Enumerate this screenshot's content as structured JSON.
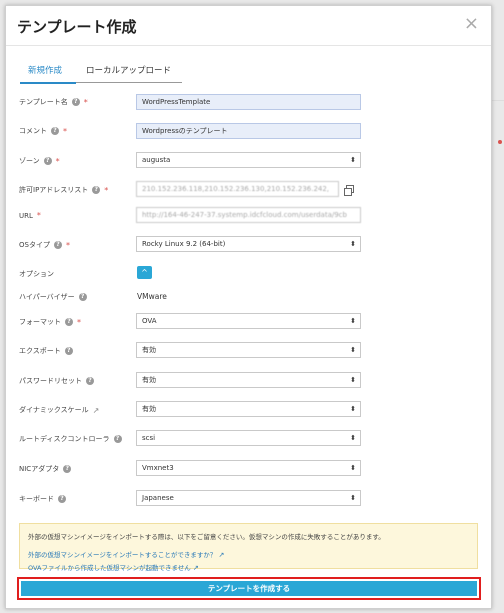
{
  "dialog": {
    "title": "テンプレート作成",
    "close": "×"
  },
  "tabs": [
    {
      "label": "新規作成",
      "active": true
    },
    {
      "label": "ローカルアップロード",
      "active": false
    }
  ],
  "help_glyph": "?",
  "required_mark": "*",
  "fields": {
    "template_name": {
      "label": "テンプレート名",
      "value": "WordPressTemplate"
    },
    "comment": {
      "label": "コメント",
      "value": "Wordpressのテンプレート"
    },
    "zone": {
      "label": "ゾーン",
      "value": "augusta"
    },
    "allowed_ip": {
      "label": "許可IPアドレスリスト",
      "value": "210.152.236.118,210.152.236.130,210.152.236.242,"
    },
    "url": {
      "label": "URL",
      "value": "http://164-46-247-37.systemp.idcfcloud.com/userdata/9cb"
    },
    "os_type": {
      "label": "OSタイプ",
      "value": "Rocky Linux 9.2 (64-bit)"
    },
    "options": {
      "label": "オプション",
      "toggle": "^"
    },
    "hypervisor": {
      "label": "ハイパーバイザー",
      "value": "VMware"
    },
    "format": {
      "label": "フォーマット",
      "value": "OVA"
    },
    "export": {
      "label": "エクスポート",
      "value": "有効"
    },
    "password_reset": {
      "label": "パスワードリセット",
      "value": "有効"
    },
    "dynamic_scale": {
      "label": "ダイナミックスケール",
      "value": "有効"
    },
    "root_disk_controller": {
      "label": "ルートディスクコントローラ",
      "value": "scsi"
    },
    "nic_adapter": {
      "label": "NICアダプタ",
      "value": "Vmxnet3"
    },
    "keyboard": {
      "label": "キーボード",
      "value": "Japanese"
    }
  },
  "caret": "⬍",
  "notice": {
    "text": "外部の仮想マシンイメージをインポートする際は、以下をご留意ください。仮想マシンの作成に失敗することがあります。",
    "link1": "外部の仮想マシンイメージをインポートすることができますか？",
    "link2": "OVAファイルから作成した仮想マシンが起動できません"
  },
  "submit_label": "テンプレートを作成する"
}
